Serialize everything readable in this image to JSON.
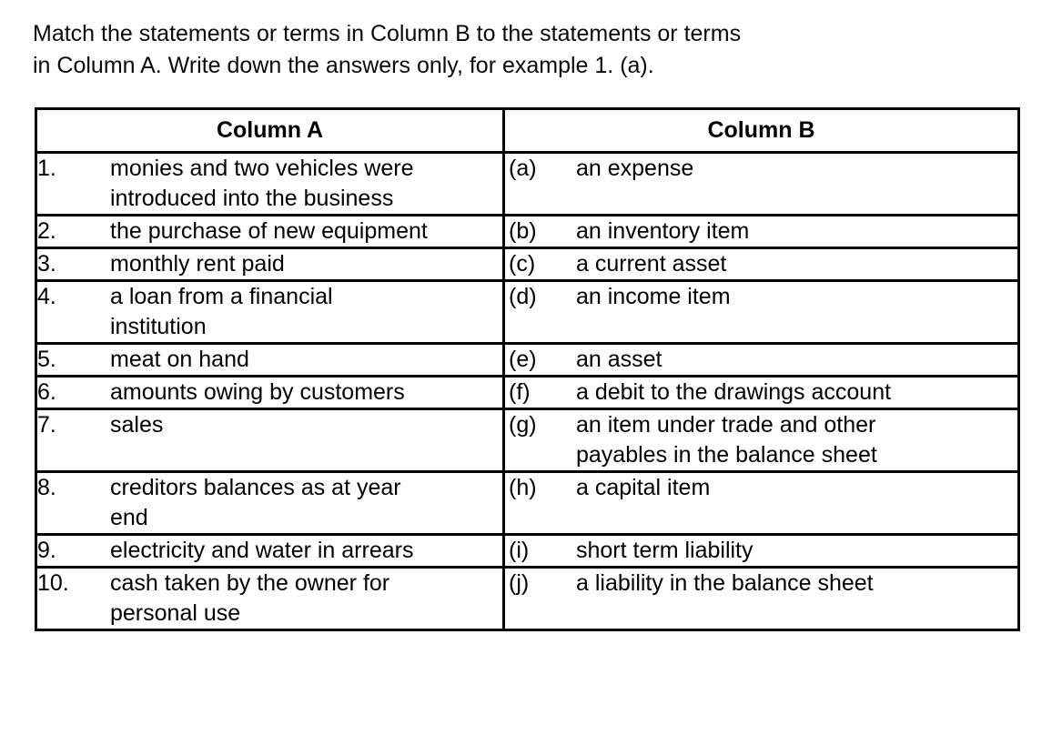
{
  "instructions": {
    "text": "Match the statements or terms in Column B to the statements or terms\nin Column A. Write down the answers only, for example 1. (a)."
  },
  "table": {
    "headers": {
      "column_a": "Column A",
      "column_b": "Column B"
    },
    "rows": [
      {
        "a_number": "1.",
        "a_text": "monies and two vehicles were\nintroduced into the business",
        "b_letter": "(a)",
        "b_text": "an expense"
      },
      {
        "a_number": "2.",
        "a_text": "the purchase of new equipment",
        "b_letter": "(b)",
        "b_text": "an inventory item"
      },
      {
        "a_number": "3.",
        "a_text": "monthly rent paid",
        "b_letter": "(c)",
        "b_text": "a current asset"
      },
      {
        "a_number": "4.",
        "a_text": "a loan from a financial\ninstitution",
        "b_letter": "(d)",
        "b_text": "an income item"
      },
      {
        "a_number": "5.",
        "a_text": "meat on hand",
        "b_letter": "(e)",
        "b_text": "an asset"
      },
      {
        "a_number": "6.",
        "a_text": "amounts owing by customers",
        "b_letter": "(f)",
        "b_text": "a debit to the drawings account"
      },
      {
        "a_number": "7.",
        "a_text": "sales",
        "b_letter": "(g)",
        "b_text": "an item under trade and other\npayables in the balance sheet"
      },
      {
        "a_number": "8.",
        "a_text": "creditors balances as at year\nend",
        "b_letter": "(h)",
        "b_text": "a capital item"
      },
      {
        "a_number": "9.",
        "a_text": "electricity and water in arrears",
        "b_letter": "(i)",
        "b_text": "short term liability"
      },
      {
        "a_number": "10.",
        "a_text": "cash taken by the owner for\npersonal use",
        "b_letter": "(j)",
        "b_text": "a liability in the balance sheet"
      }
    ]
  },
  "colors": {
    "text": "#000000",
    "background": "#ffffff",
    "border": "#000000"
  }
}
